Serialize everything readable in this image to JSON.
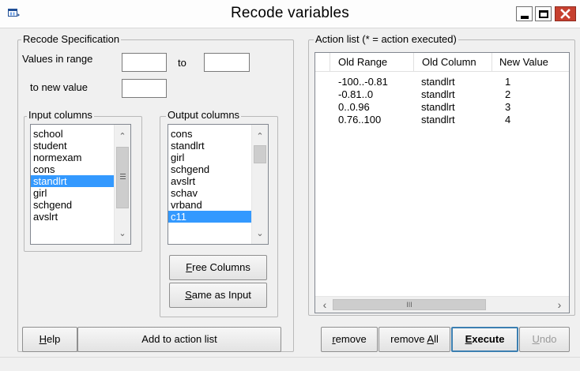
{
  "window": {
    "title": "Recode variables"
  },
  "recode_spec": {
    "legend": "Recode Specification",
    "values_in_range_label": "Values in range",
    "to_label": "to",
    "to_new_value_label": "to new value",
    "range_from_value": "",
    "range_to_value": "",
    "new_value": ""
  },
  "input_columns": {
    "legend": "Input columns",
    "items": [
      "school",
      "student",
      "normexam",
      "cons",
      "standlrt",
      "girl",
      "schgend",
      "avslrt"
    ],
    "selected": "standlrt"
  },
  "output_columns": {
    "legend": "Output columns",
    "items": [
      "cons",
      "standlrt",
      "girl",
      "schgend",
      "avslrt",
      "schav",
      "vrband",
      "c11"
    ],
    "selected": "c11"
  },
  "buttons": {
    "free_columns_mnemonic": "F",
    "free_columns_rest": "ree Columns",
    "same_as_input_mnemonic": "S",
    "same_as_input_rest": "ame as Input",
    "help_mnemonic": "H",
    "help_rest": "elp",
    "add_to_action_list": "Add to action list",
    "remove_mnemonic": "r",
    "remove_rest": "emove",
    "remove_all_prefix": "remove ",
    "remove_all_mnemonic": "A",
    "remove_all_rest": "ll",
    "execute_mnemonic": "E",
    "execute_rest": "xecute",
    "undo_mnemonic": "U",
    "undo_rest": "ndo"
  },
  "action_list": {
    "legend": "Action list (* = action executed)",
    "columns": [
      "Old Range",
      "Old Column",
      "New Value"
    ],
    "rows": [
      {
        "old_range": "-100..-0.81",
        "old_column": "standlrt",
        "new_value": "1"
      },
      {
        "old_range": "-0.81..0",
        "old_column": "standlrt",
        "new_value": "2"
      },
      {
        "old_range": "0..0.96",
        "old_column": "standlrt",
        "new_value": "3"
      },
      {
        "old_range": "0.76..100",
        "old_column": "standlrt",
        "new_value": "4"
      }
    ],
    "hscroll_thumb_glyph": "III"
  },
  "icons": {
    "app": "app-window-icon",
    "minimize": "minimize-icon",
    "maximize": "maximize-icon",
    "close": "close-icon"
  },
  "colors": {
    "selection": "#3399ff",
    "close_button": "#c7402f",
    "default_button_border": "#3c7fb1"
  }
}
